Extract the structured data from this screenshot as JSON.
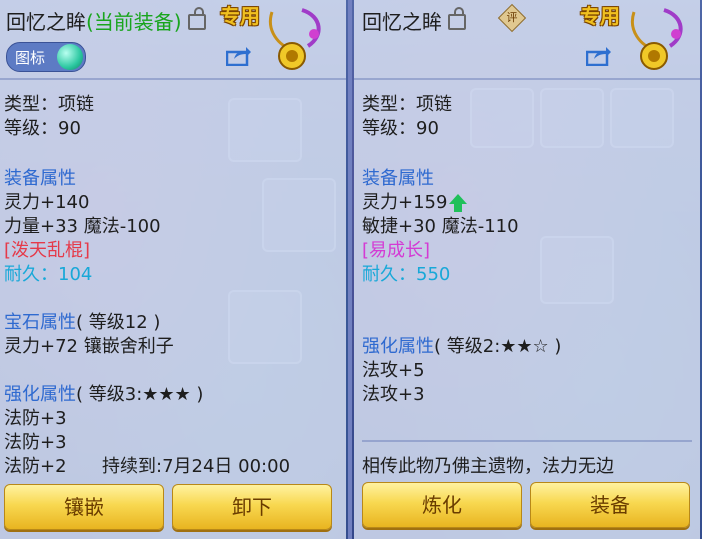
{
  "left_panel": {
    "title": "回忆之眸",
    "title_status": "(当前装备)",
    "tag": "专用",
    "toggle_label": "图标",
    "type_line": "类型：项链",
    "level_line": "等级：90",
    "equip_header": "装备属性",
    "stat1": "灵力+140",
    "stat2": "力量+33 魔法-100",
    "special_name": "[泼天乱棍]",
    "durability": "耐久：104",
    "gem_header": "宝石属性",
    "gem_level": "( 等级12 )",
    "gem_stat": "灵力+72 镶嵌舍利子",
    "enhance_header": "强化属性",
    "enhance_level": "( 等级3:★★★ )",
    "enhance_stats": [
      "法防+3",
      "法防+3",
      "法防+2"
    ],
    "duration": "持续到:7月24日 00:00",
    "buttons": [
      "镶嵌",
      "卸下"
    ]
  },
  "right_panel": {
    "title": "回忆之眸",
    "rating_icon_text": "评",
    "tag": "专用",
    "type_line": "类型：项链",
    "level_line": "等级：90",
    "equip_header": "装备属性",
    "stat1": "灵力+159",
    "stat2": "敏捷+30 魔法-110",
    "special_name": "[易成长]",
    "durability": "耐久：550",
    "enhance_header": "强化属性",
    "enhance_level": "( 等级2:★★☆ )",
    "enhance_stats": [
      "法攻+5",
      "法攻+3"
    ],
    "description": "相传此物乃佛主遗物，法力无边",
    "buttons": [
      "炼化",
      "装备"
    ]
  },
  "colors": {
    "title_status_green": "#19a51d",
    "header_blue": "#2f6ad0",
    "special_red": "#e53a4a",
    "special_pink": "#d43ad4",
    "durability_cyan": "#18a8d8",
    "button_gold": "#f8d850"
  },
  "icons": [
    "lock-icon",
    "share-icon",
    "necklace-icon",
    "rating-icon",
    "stat-up-arrow-icon"
  ]
}
